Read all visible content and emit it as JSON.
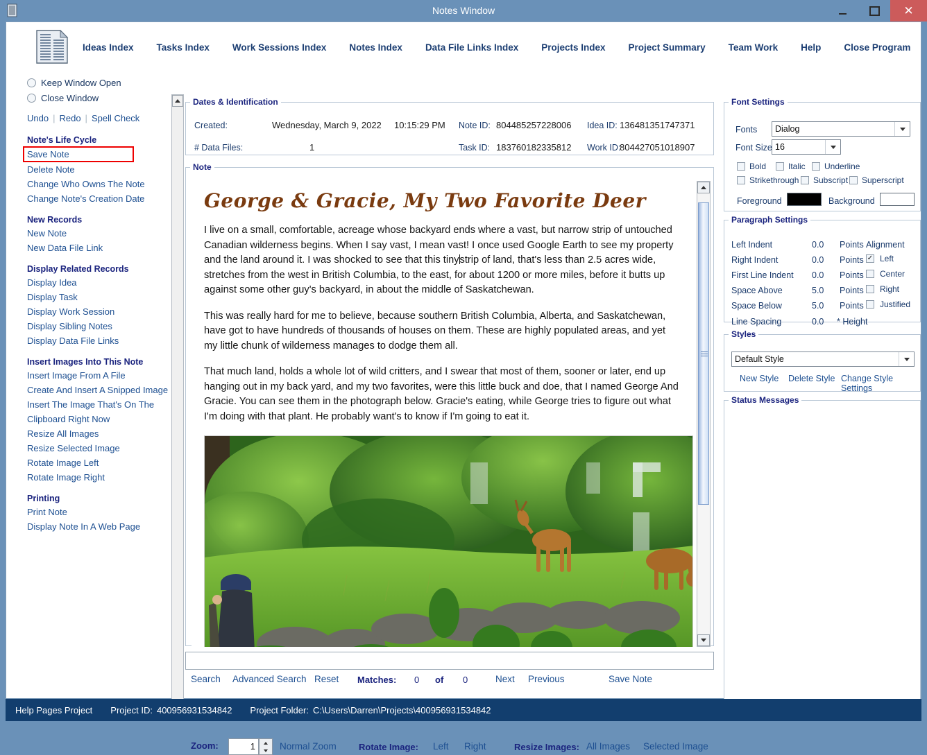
{
  "window": {
    "title": "Notes Window",
    "minimize": "–",
    "maximize": "□",
    "close": "✕"
  },
  "topnav": [
    {
      "label": "Ideas Index",
      "mnemonic": "I"
    },
    {
      "label": "Tasks Index",
      "mnemonic": "T"
    },
    {
      "label": "Work Sessions Index",
      "mnemonic": "W"
    },
    {
      "label": "Notes Index",
      "mnemonic": "N"
    },
    {
      "label": "Data File Links Index",
      "mnemonic": "D"
    },
    {
      "label": "Projects Index",
      "mnemonic": "P"
    },
    {
      "label": "Project Summary",
      "mnemonic": "S"
    },
    {
      "label": "Team Work",
      "mnemonic": "e"
    },
    {
      "label": "Help",
      "mnemonic": "H"
    },
    {
      "label": "Close Program",
      "mnemonic": "C"
    }
  ],
  "sidebar": {
    "radios": [
      {
        "label": "Keep Window Open",
        "selected": false
      },
      {
        "label": "Close Window",
        "selected": false
      }
    ],
    "edit_actions": [
      "Undo",
      "Redo",
      "Spell Check"
    ],
    "sections": [
      {
        "heading": "Note's Life Cycle",
        "items": [
          "Save Note",
          "Delete Note",
          "Change Who Owns The Note",
          "Change Note's Creation Date"
        ],
        "highlighted": "Save Note"
      },
      {
        "heading": "New Records",
        "items": [
          "New Note",
          "New Data File Link"
        ]
      },
      {
        "heading": "Display Related Records",
        "items": [
          "Display Idea",
          "Display Task",
          "Display Work Session",
          "Display Sibling Notes",
          "Display Data File Links"
        ]
      },
      {
        "heading": "Insert Images Into This Note",
        "items": [
          "Insert Image From A File",
          "Create And Insert A Snipped Image",
          "Insert The Image That's On The Clipboard Right Now",
          "Resize All Images",
          "Resize Selected Image",
          "Rotate Image Left",
          "Rotate Image Right"
        ]
      },
      {
        "heading": "Printing",
        "items": [
          "Print Note",
          "Display Note In A Web Page"
        ]
      }
    ]
  },
  "dates": {
    "legend": "Dates & Identification",
    "created_label": "Created:",
    "created_value": "Wednesday, March 9, 2022",
    "created_time": "10:15:29 PM",
    "datafiles_label": "# Data Files:",
    "datafiles_value": "1",
    "note_id_label": "Note ID:",
    "note_id_value": "804485257228006",
    "idea_id_label": "Idea ID:",
    "idea_id_value": "136481351747371",
    "task_id_label": "Task ID:",
    "task_id_value": "183760182335812",
    "work_id_label": "Work ID:",
    "work_id_value": "804427051018907"
  },
  "note": {
    "legend": "Note",
    "title": "George & Gracie, My Two Favorite Deer",
    "paragraph1a": "I live on a small, comfortable, acreage whose backyard ends where a vast, but narrow strip of untouched Canadian wilderness begins. When I say vast, I mean vast! I once used Google Earth to see my property and the land around it. I was shocked to see that this tiny",
    "paragraph1b": "strip of land, that's less than 2.5 acres wide, stretches from the west in British Columbia, to the east, for about 1200 or more miles, before it butts up against some other guy's backyard, in about the middle of Saskatchewan.",
    "paragraph2": "This was really hard for me to believe, because southern British Columbia, Alberta, and Saskatchewan, have got to have hundreds of thousands of houses on them. These are highly populated areas, and yet my little chunk of wilderness manages to dodge them all.",
    "paragraph3": "That much land, holds a whole lot of wild critters, and I swear that most of them, sooner or later, end up hanging out in my back yard, and my two favorites, were this little buck and doe, that I named George And Gracie. You can see them in the photograph below. Gracie's eating, while George tries to figure out what I'm doing with that plant. He probably want's to know if I'm going to eat it.",
    "photo_alt": "Photograph of two deer grazing in a green backyard meadow with a man in a blue cap watching"
  },
  "search_bar": {
    "input_value": "",
    "search": "Search",
    "advanced_search": "Advanced Search",
    "reset": "Reset",
    "matches_label": "Matches:",
    "matches_current": "0",
    "of": "of",
    "matches_total": "0",
    "next": "Next",
    "previous": "Previous",
    "save_note": "Save Note"
  },
  "zoom_bar": {
    "zoom_label": "Zoom:",
    "zoom_value": "1",
    "normal_zoom": "Normal Zoom",
    "rotate_label": "Rotate Image:",
    "rotate_left": "Left",
    "rotate_right": "Right",
    "resize_label": "Resize Images:",
    "resize_all": "All Images",
    "resize_selected": "Selected Image"
  },
  "font_settings": {
    "legend": "Font Settings",
    "fonts_label": "Fonts",
    "fonts_value": "Dialog",
    "size_label": "Font Size",
    "size_value": "16",
    "checkboxes": [
      {
        "label": "Bold",
        "checked": false
      },
      {
        "label": "Italic",
        "checked": false
      },
      {
        "label": "Underline",
        "checked": false
      },
      {
        "label": "Strikethrough",
        "checked": false
      },
      {
        "label": "Subscript",
        "checked": false
      },
      {
        "label": "Superscript",
        "checked": false
      }
    ],
    "foreground_label": "Foreground",
    "foreground_color": "#000000",
    "background_label": "Background",
    "background_color": "#ffffff"
  },
  "paragraph_settings": {
    "legend": "Paragraph Settings",
    "rows": [
      {
        "label": "Left Indent",
        "value": "0.0",
        "unit": "Points"
      },
      {
        "label": "Right Indent",
        "value": "0.0",
        "unit": "Points"
      },
      {
        "label": "First Line Indent",
        "value": "0.0",
        "unit": "Points"
      },
      {
        "label": "Space Above",
        "value": "5.0",
        "unit": "Points"
      },
      {
        "label": "Space Below",
        "value": "5.0",
        "unit": "Points"
      },
      {
        "label": "Line Spacing",
        "value": "0.0",
        "unit": "* Height"
      }
    ],
    "alignment_label": "Alignment",
    "alignment": [
      {
        "label": "Left",
        "checked": true
      },
      {
        "label": "Center",
        "checked": false
      },
      {
        "label": "Right",
        "checked": false
      },
      {
        "label": "Justified",
        "checked": false
      }
    ]
  },
  "styles": {
    "legend": "Styles",
    "selected": "Default Style",
    "new_style": "New Style",
    "delete_style": "Delete Style",
    "change_style": "Change Style Settings"
  },
  "status_messages": {
    "legend": "Status Messages",
    "content": ""
  },
  "statusbar": {
    "project_name": "Help Pages Project",
    "project_id_label": "Project ID:",
    "project_id_value": "400956931534842",
    "project_folder_label": "Project Folder:",
    "project_folder_value": "C:\\Users\\Darren\\Projects\\400956931534842"
  },
  "colors": {
    "titlebar": "#6a91b8",
    "close_button": "#cc5b5b",
    "link": "#1d4f91",
    "heading": "#1a237e",
    "highlight_border": "#ee0000",
    "statusbar": "#123e6e",
    "note_title": "#7a3b10"
  }
}
